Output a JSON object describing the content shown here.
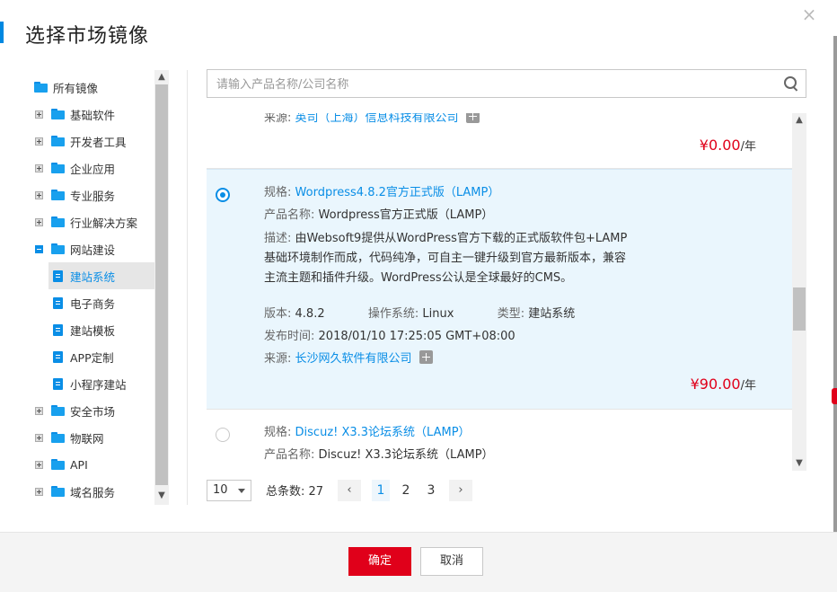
{
  "dialog": {
    "title": "选择市场镜像",
    "close_glyph": "×"
  },
  "tree": {
    "root": "所有镜像",
    "categories": [
      {
        "label": "基础软件",
        "state": "collapsed"
      },
      {
        "label": "开发者工具",
        "state": "collapsed"
      },
      {
        "label": "企业应用",
        "state": "collapsed"
      },
      {
        "label": "专业服务",
        "state": "collapsed"
      },
      {
        "label": "行业解决方案",
        "state": "collapsed"
      },
      {
        "label": "网站建设",
        "state": "expanded"
      }
    ],
    "children": [
      {
        "label": "建站系统",
        "selected": true
      },
      {
        "label": "电子商务"
      },
      {
        "label": "建站模板"
      },
      {
        "label": "APP定制"
      },
      {
        "label": "小程序建站"
      }
    ],
    "more_categories": [
      {
        "label": "安全市场"
      },
      {
        "label": "物联网"
      },
      {
        "label": "API"
      },
      {
        "label": "域名服务"
      }
    ]
  },
  "search": {
    "placeholder": "请输入产品名称/公司名称",
    "value": ""
  },
  "products": [
    {
      "source_label": "来源:",
      "source": "英司（上海）信息科技有限公司",
      "price": "¥0.00",
      "unit": "/年"
    },
    {
      "selected": true,
      "spec_label": "规格:",
      "spec": "Wordpress4.8.2官方正式版（LAMP）",
      "name_label": "产品名称:",
      "name": "Wordpress官方正式版（LAMP）",
      "desc_label": "描述:",
      "desc": "由Websoft9提供从WordPress官方下载的正式版软件包+LAMP基础环境制作而成，代码纯净，可自主一键升级到官方最新版本，兼容主流主题和插件升级。WordPress公认是全球最好的CMS。",
      "version_label": "版本:",
      "version": "4.8.2",
      "os_label": "操作系统:",
      "os": "Linux",
      "type_label": "类型:",
      "type": "建站系统",
      "release_label": "发布时间:",
      "release": "2018/01/10 17:25:05 GMT+08:00",
      "source_label": "来源:",
      "source": "长沙网久软件有限公司",
      "price": "¥90.00",
      "unit": "/年"
    },
    {
      "spec_label": "规格:",
      "spec": "Discuz! X3.3论坛系统（LAMP）",
      "name_label": "产品名称:",
      "name": "Discuz! X3.3论坛系统（LAMP）"
    }
  ],
  "pagination": {
    "page_size": "10",
    "total_label": "总条数: 27",
    "prev": "‹",
    "next": "›",
    "pages": [
      "1",
      "2",
      "3"
    ],
    "current": "1"
  },
  "footer": {
    "ok": "确定",
    "cancel": "取消"
  },
  "colors": {
    "accent": "#0a8ee6",
    "price_red": "#e0001a",
    "selected_bg": "#eaf6fd"
  },
  "icons": [
    "folder-icon",
    "document-icon",
    "expand-plus-icon",
    "collapse-minus-icon",
    "search-icon",
    "close-icon",
    "chevron-down-icon",
    "chevron-left-icon",
    "chevron-right-icon",
    "add-icon"
  ]
}
